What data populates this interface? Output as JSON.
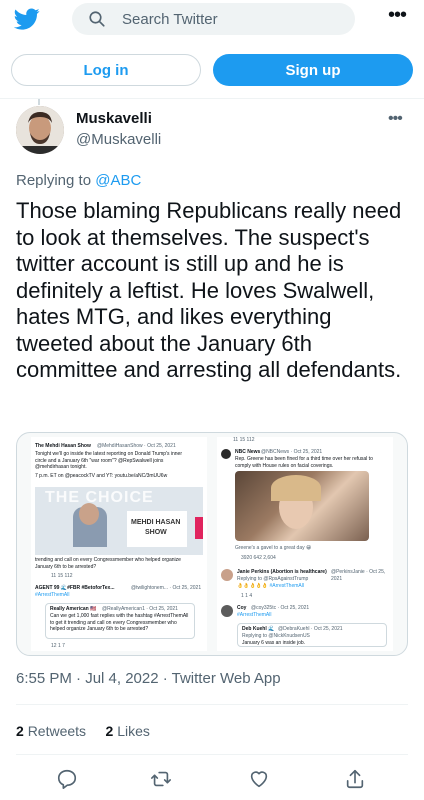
{
  "header": {
    "logo_icon": "twitter-bird-icon",
    "search_placeholder": "Search Twitter",
    "more_icon": "more-horizontal-icon",
    "more_label": "•••"
  },
  "auth": {
    "login_label": "Log in",
    "signup_label": "Sign up"
  },
  "tweet": {
    "author_name": "Muskavelli",
    "author_handle": "@Muskavelli",
    "more_label": "•••",
    "replying_prefix": "Replying to",
    "replying_mention": "@ABC",
    "text": "Those blaming Republicans really need to look at themselves. The suspect's twitter account is still up and he is definitely a leftist. He loves Swalwell, hates MTG, and likes everything tweeted about the January 6th committee and arresting all defendants.",
    "timestamp": "6:55 PM · Jul 4, 2022 · Twitter Web App",
    "retweets_count": "2",
    "retweets_label": "Retweets",
    "likes_count": "2",
    "likes_label": "Likes"
  },
  "media": {
    "left_tweet_header": "The Mehdi Hasan Show",
    "left_tweet_meta": "@MehdiHasanShow · Oct 25, 2021",
    "left_tweet_body": "Tonight we'll go inside the latest reporting on Donald Trump's inner circle and a January 6th \"war room\"? @RepSwalwell joins @mehdirhasan tonight.",
    "left_tweet_time": "7 p.m. ET on @peacockTV and YT: youtu.be/aNC/3mUU6w",
    "show_overlay": "THE CHOICE",
    "show_name_1": "MEHDI HASAN",
    "show_name_2": "SHOW",
    "left_reply_text": "trending and call on every Congressmember who helped organize January 6th to be arrested?",
    "left_reply2_name": "AGENT 99 🌊#FBR #BetoforTex...",
    "left_reply2_meta": "@twilightonem... · Oct 25, 2021",
    "left_reply2_tag": "#ArrestThemAll",
    "left_quote_name": "Really American 🇺🇸",
    "left_quote_meta": "@ReallyAmerican1 · Oct 25, 2021",
    "left_quote_body": "Can we get 1,000 fast replies with the hashtag #ArrestThemAll to get it trending and call on every Congressmember who helped organize January 6th to be arrested?",
    "right_tweet_name": "NBC News",
    "right_tweet_meta": "@NBCNews · Oct 25, 2021",
    "right_tweet_body": "Rep. Greene has been fined for a third time over her refusal to comply with House rules on facial coverings.",
    "right_caption": "Greene's a gavel to a great day 😀",
    "right_stats": "3920   642   2,604",
    "right_reply1_name": "Janie Perkins (Abortion is healthcare)",
    "right_reply1_meta": "@PerkinsJanie · Oct 25, 2021",
    "right_reply1_sub": "Replying to @RpsAgainstTrump",
    "right_reply1_tag": "👌👌👌👌👌 #ArrestThemAll",
    "right_reply2_name": "Coy",
    "right_reply2_meta": "@coy325tc · Oct 25, 2021",
    "right_reply2_tag": "#ArrestThemAll",
    "right_quote_name": "Deb Kuehl 🌊",
    "right_quote_meta": "@DebraKuehl · Oct 25, 2021",
    "right_quote_sub": "Replying to @NickKnudsenUS",
    "right_quote_body": "January 6 was an inside job.",
    "counts_a": "11   15   112",
    "counts_b": "12   1   7",
    "counts_c": "1   1   4"
  },
  "actions": {
    "reply_icon": "reply-icon",
    "retweet_icon": "retweet-icon",
    "like_icon": "heart-icon",
    "share_icon": "share-icon"
  },
  "colors": {
    "brand": "#1d9bf0",
    "text": "#0f1419",
    "secondary": "#536471"
  }
}
